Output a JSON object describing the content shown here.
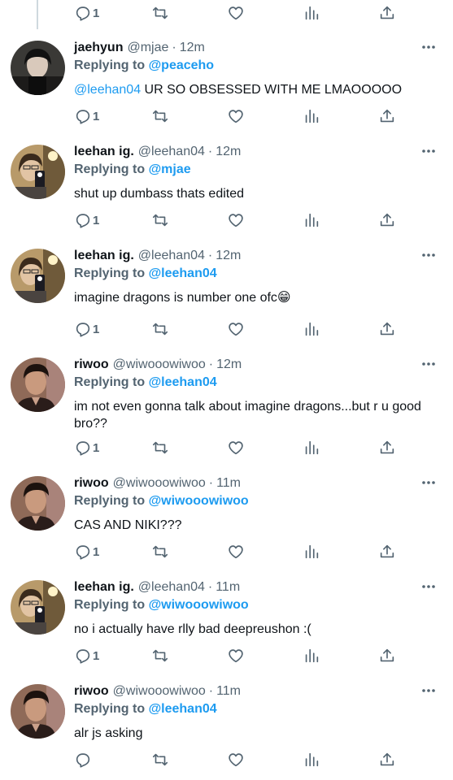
{
  "top_actions": {
    "reply_count": "1"
  },
  "tweets": [
    {
      "name": "jaehyun",
      "handle": "@mjae",
      "time": "12m",
      "replying_prefix": "Replying to ",
      "replying_to": "@peaceho",
      "mention": "@leehan04",
      "text": " UR SO OBSESSED WITH ME LMAOOOOO",
      "reply_count": "1",
      "avatar": "avatar-dark-hair"
    },
    {
      "name": "leehan ig.",
      "handle": "@leehan04",
      "time": "12m",
      "replying_prefix": "Replying to ",
      "replying_to": "@mjae",
      "mention": "",
      "text": "shut up dumbass thats edited",
      "reply_count": "1",
      "avatar": "avatar-mirror-selfie"
    },
    {
      "name": "leehan ig.",
      "handle": "@leehan04",
      "time": "12m",
      "replying_prefix": "Replying to ",
      "replying_to": "@leehan04",
      "mention": "",
      "text": "imagine dragons is number one ofc😁",
      "reply_count": "1",
      "avatar": "avatar-mirror-selfie"
    },
    {
      "name": "riwoo",
      "handle": "@wiwooowiwoo",
      "time": "12m",
      "replying_prefix": "Replying to ",
      "replying_to": "@leehan04",
      "mention": "",
      "text": "im not even gonna talk about imagine dragons...but r u good\nbro??",
      "reply_count": "1",
      "avatar": "avatar-portrait"
    },
    {
      "name": "riwoo",
      "handle": "@wiwooowiwoo",
      "time": "11m",
      "replying_prefix": "Replying to ",
      "replying_to": "@wiwooowiwoo",
      "mention": "",
      "text": "CAS AND NIKI???",
      "reply_count": "1",
      "avatar": "avatar-portrait"
    },
    {
      "name": "leehan ig.",
      "handle": "@leehan04",
      "time": "11m",
      "replying_prefix": "Replying to ",
      "replying_to": "@wiwooowiwoo",
      "mention": "",
      "text": "no i actually have rlly bad deepreushon :(",
      "reply_count": "1",
      "avatar": "avatar-mirror-selfie"
    },
    {
      "name": "riwoo",
      "handle": "@wiwooowiwoo",
      "time": "11m",
      "replying_prefix": "Replying to ",
      "replying_to": "@leehan04",
      "mention": "",
      "text": "alr js asking",
      "reply_count": "",
      "avatar": "avatar-portrait"
    }
  ],
  "separator": "·",
  "colors": {
    "link": "#1d9bf0",
    "secondary": "#536471",
    "text": "#0f1419",
    "thread_line": "#cfd9de"
  },
  "icons": [
    "reply-icon",
    "retweet-icon",
    "like-icon",
    "views-icon",
    "share-icon",
    "more-icon"
  ]
}
